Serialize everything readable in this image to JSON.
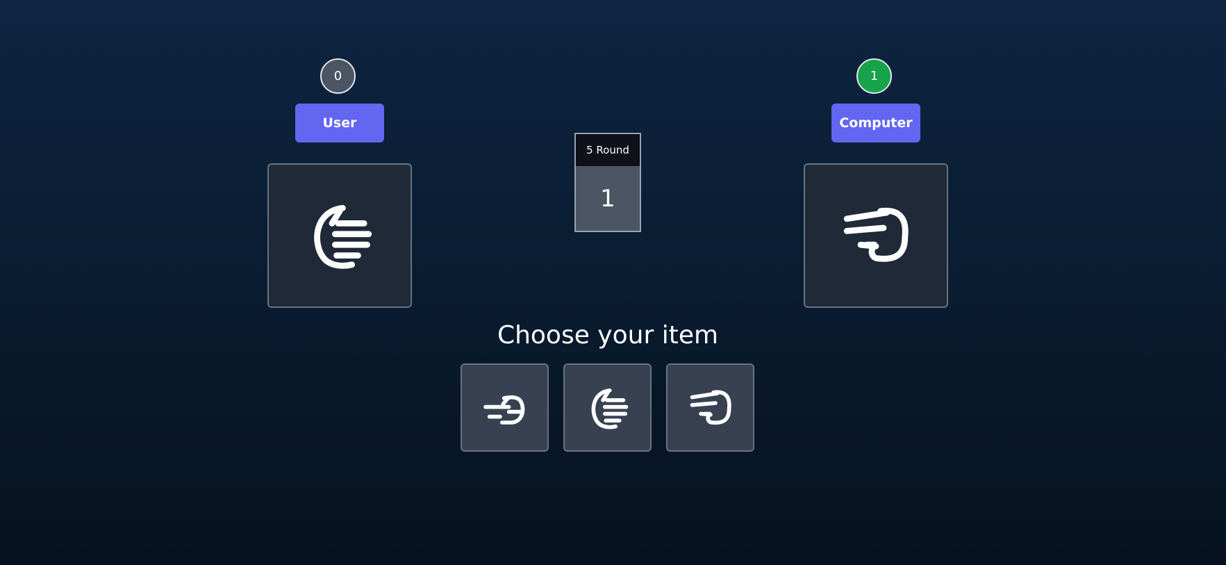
{
  "players": {
    "user": {
      "score": "0",
      "label": "User",
      "pick": "hand-paper-icon"
    },
    "computer": {
      "score": "1",
      "label": "Computer",
      "pick": "hand-scissors-icon"
    }
  },
  "round": {
    "label": "5 Round",
    "value": "1"
  },
  "chooser": {
    "title": "Choose your item",
    "items": [
      "hand-pointing-icon",
      "hand-paper-icon",
      "hand-scissors-icon"
    ]
  },
  "colors": {
    "accent": "#6366f1",
    "winner_score": "#16a34a",
    "neutral_score": "#4b5563",
    "card": "#1f2937",
    "choice_card": "#374151"
  }
}
